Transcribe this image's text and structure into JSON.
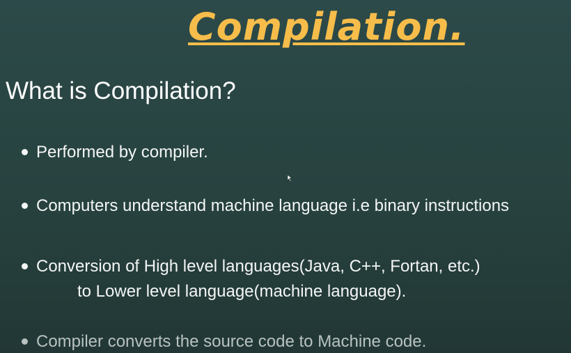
{
  "slide": {
    "title": "Compilation.",
    "subtitle": "What is Compilation?",
    "bullets": [
      "Performed by compiler.",
      "Computers understand machine language i.e binary instructions",
      "Conversion of High level languages(Java, C++, Fortan, etc.)",
      "Compiler converts the source code to Machine code."
    ],
    "bullet3_continuation": "to Lower level language(machine language)."
  },
  "colors": {
    "background": "#2c4a49",
    "title": "#f7bd4a",
    "text": "#f3f6f5",
    "muted_text": "#b8c2c0"
  }
}
